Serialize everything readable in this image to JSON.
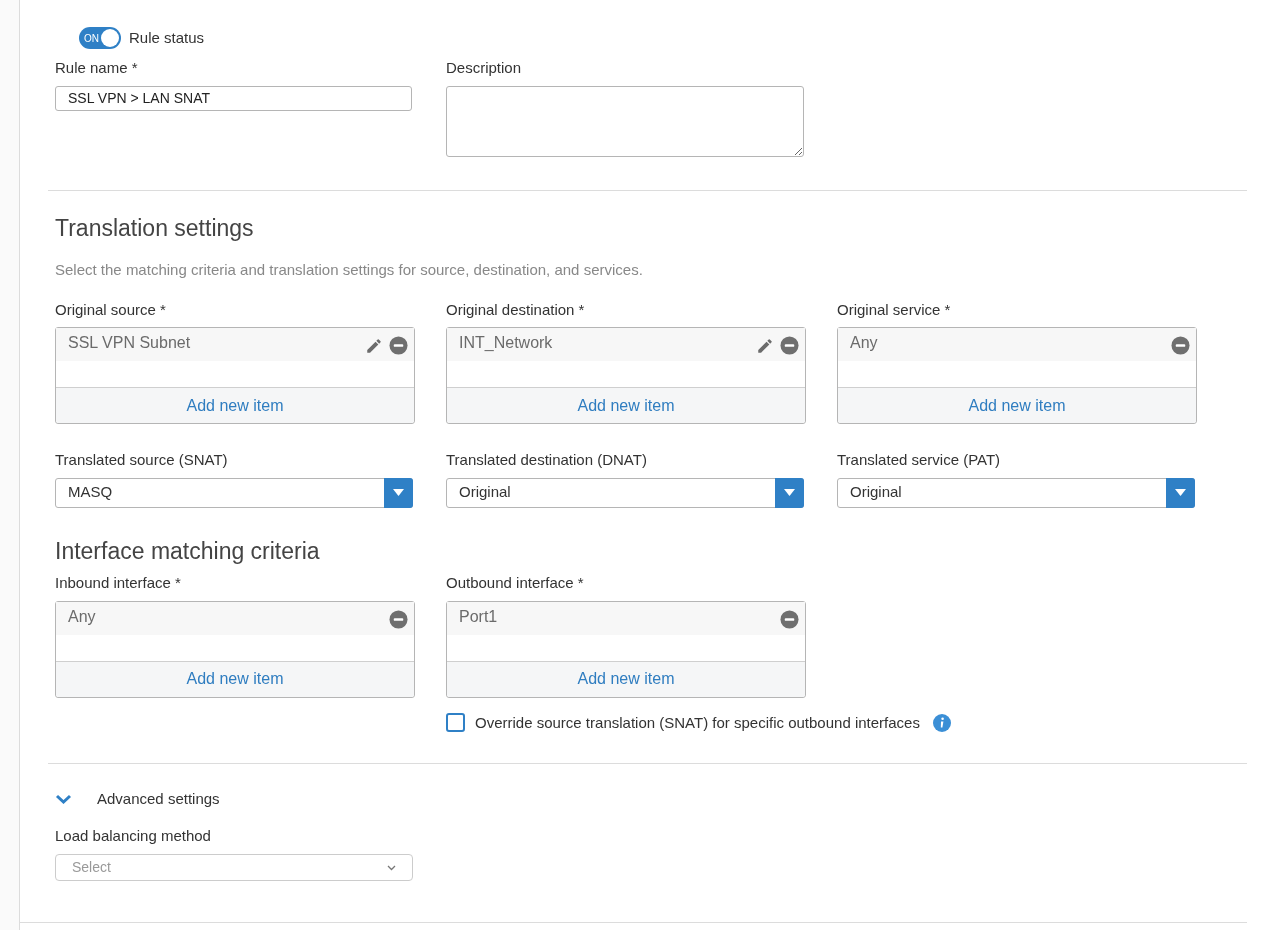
{
  "rule_status": {
    "toggle_text": "ON",
    "on": true,
    "label": "Rule status"
  },
  "rule_name": {
    "label": "Rule name *",
    "value": "SSL VPN > LAN SNAT"
  },
  "description": {
    "label": "Description"
  },
  "translation_settings": {
    "title": "Translation settings",
    "subtitle": "Select the matching criteria and translation settings for source, destination, and services.",
    "lists": [
      {
        "label": "Original source *",
        "items": [
          {
            "text": "SSL VPN Subnet",
            "editable": true
          }
        ],
        "add_label": "Add new item"
      },
      {
        "label": "Original destination *",
        "items": [
          {
            "text": "INT_Network",
            "editable": true
          }
        ],
        "add_label": "Add new item"
      },
      {
        "label": "Original service *",
        "items": [
          {
            "text": "Any",
            "editable": false
          }
        ],
        "add_label": "Add new item"
      }
    ],
    "selects": [
      {
        "label": "Translated source (SNAT)",
        "value": "MASQ"
      },
      {
        "label": "Translated destination (DNAT)",
        "value": "Original"
      },
      {
        "label": "Translated service (PAT)",
        "value": "Original"
      }
    ]
  },
  "interface_matching": {
    "title": "Interface matching criteria",
    "lists": [
      {
        "label": "Inbound interface *",
        "items": [
          {
            "text": "Any",
            "editable": false
          }
        ],
        "add_label": "Add new item"
      },
      {
        "label": "Outbound interface *",
        "items": [
          {
            "text": "Port1",
            "editable": false
          }
        ],
        "add_label": "Add new item"
      }
    ],
    "override": {
      "label": "Override source translation (SNAT) for specific outbound interfaces",
      "checked": false
    }
  },
  "advanced": {
    "title": "Advanced settings",
    "expanded": true,
    "load_balancing": {
      "label": "Load balancing method",
      "placeholder": "Select"
    }
  }
}
